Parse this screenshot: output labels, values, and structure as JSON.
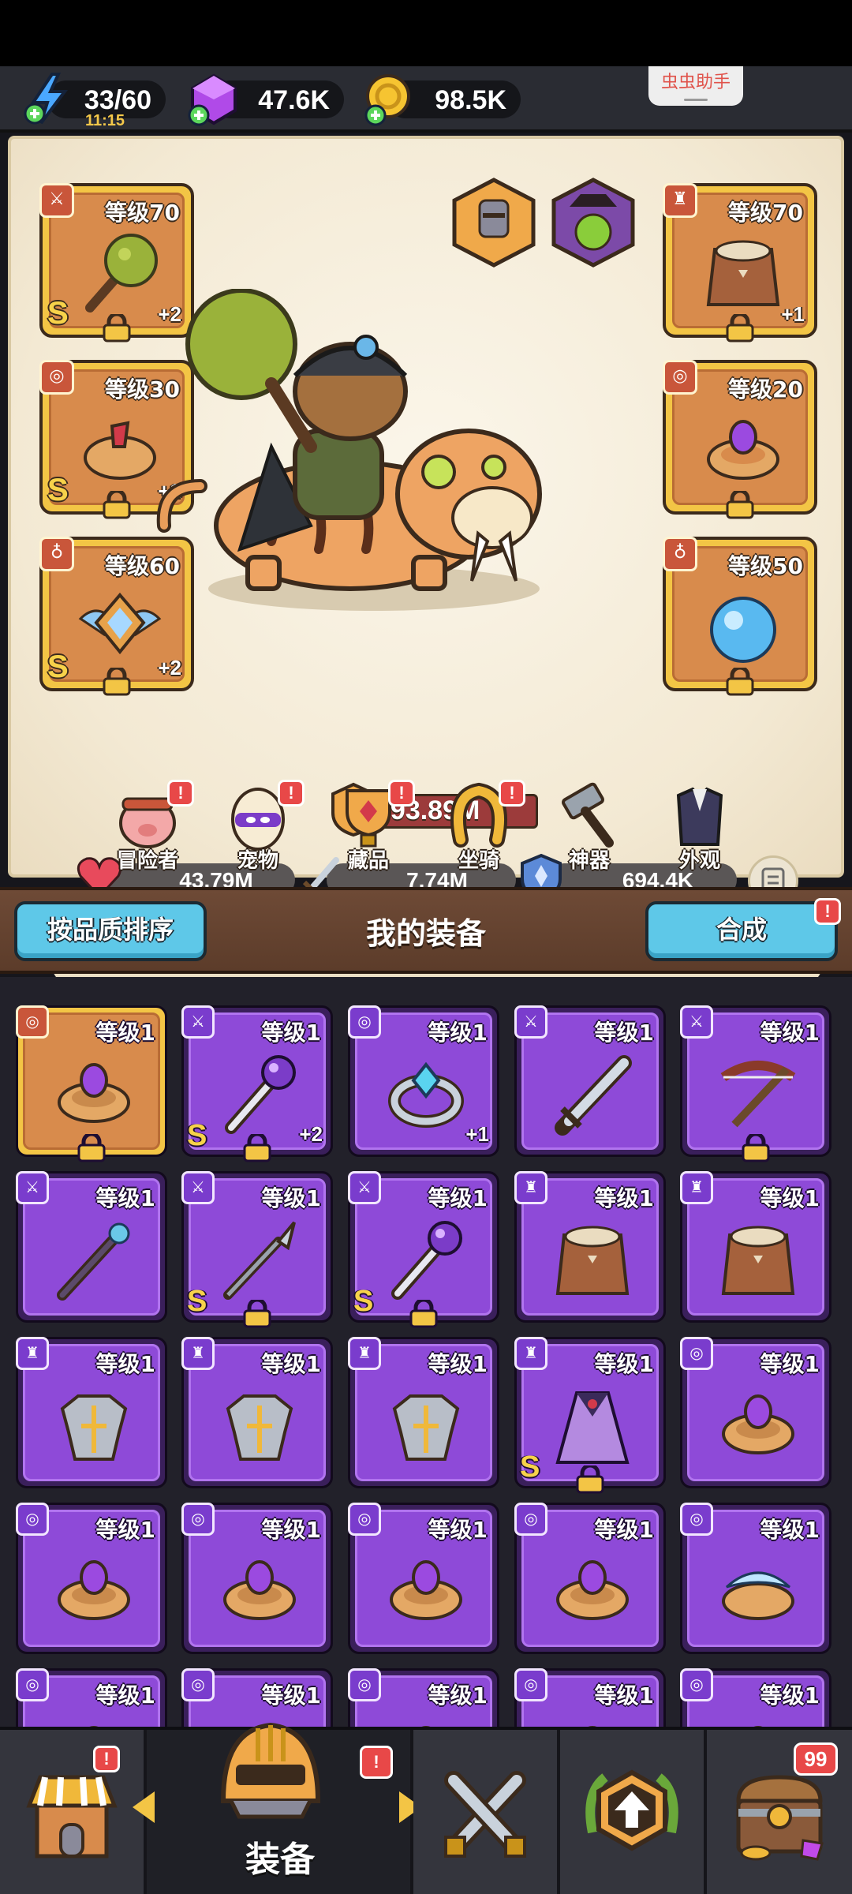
{
  "resources": {
    "energy": "33/60",
    "energy_timer": "11:15",
    "gems": "47.6K",
    "gold": "98.5K"
  },
  "helper_label": "虫虫助手",
  "equipped": {
    "left": [
      {
        "level": "等级70",
        "grade": "S",
        "plus": "+2",
        "slot": "weapon"
      },
      {
        "level": "等级30",
        "grade": "S",
        "plus": "+1",
        "slot": "ring"
      },
      {
        "level": "等级60",
        "grade": "S",
        "plus": "+2",
        "slot": "amulet"
      }
    ],
    "right": [
      {
        "level": "等级70",
        "plus": "+1",
        "slot": "armor"
      },
      {
        "level": "等级20",
        "slot": "ring"
      },
      {
        "level": "等级50",
        "slot": "amulet"
      }
    ]
  },
  "stats": {
    "power": "193.89M",
    "hp": "43.79M",
    "attack": "7.74M",
    "defense": "694.4K"
  },
  "nav": [
    {
      "label": "冒险者",
      "badge": "!"
    },
    {
      "label": "宠物",
      "badge": "!"
    },
    {
      "label": "藏品",
      "badge": "!"
    },
    {
      "label": "坐骑",
      "badge": "!"
    },
    {
      "label": "神器",
      "badge": ""
    },
    {
      "label": "外观",
      "badge": ""
    }
  ],
  "inventory": {
    "sort_label": "按品质排序",
    "title": "我的装备",
    "combine_label": "合成",
    "combine_badge": "!",
    "items": [
      {
        "level": "等级1",
        "type": "ring"
      },
      {
        "level": "等级1",
        "grade": "S",
        "plus": "+2",
        "type": "staff"
      },
      {
        "level": "等级1",
        "plus": "+1",
        "type": "ring-blue"
      },
      {
        "level": "等级1",
        "type": "sword"
      },
      {
        "level": "等级1",
        "type": "crossbow"
      },
      {
        "level": "等级1",
        "type": "wand"
      },
      {
        "level": "等级1",
        "grade": "S",
        "type": "spear"
      },
      {
        "level": "等级1",
        "grade": "S",
        "type": "staff"
      },
      {
        "level": "等级1",
        "type": "fur-armor"
      },
      {
        "level": "等级1",
        "type": "fur-armor"
      },
      {
        "level": "等级1",
        "type": "plate-armor"
      },
      {
        "level": "等级1",
        "type": "plate-armor"
      },
      {
        "level": "等级1",
        "type": "plate-armor"
      },
      {
        "level": "等级1",
        "grade": "S",
        "type": "robe"
      },
      {
        "level": "等级1",
        "type": "ring"
      },
      {
        "level": "等级1",
        "type": "ring"
      },
      {
        "level": "等级1",
        "type": "ring"
      },
      {
        "level": "等级1",
        "type": "ring"
      },
      {
        "level": "等级1",
        "type": "ring"
      },
      {
        "level": "等级1",
        "type": "ring-wing"
      },
      {
        "level": "等级1",
        "type": "ring"
      },
      {
        "level": "等级1",
        "type": "ring"
      },
      {
        "level": "等级1",
        "type": "ring"
      },
      {
        "level": "等级1",
        "type": "ring"
      },
      {
        "level": "等级1",
        "type": "ring"
      }
    ]
  },
  "bottom_nav": {
    "active_label": "装备",
    "shop_badge": "!",
    "equip_badge": "!",
    "chest_badge": "99"
  }
}
